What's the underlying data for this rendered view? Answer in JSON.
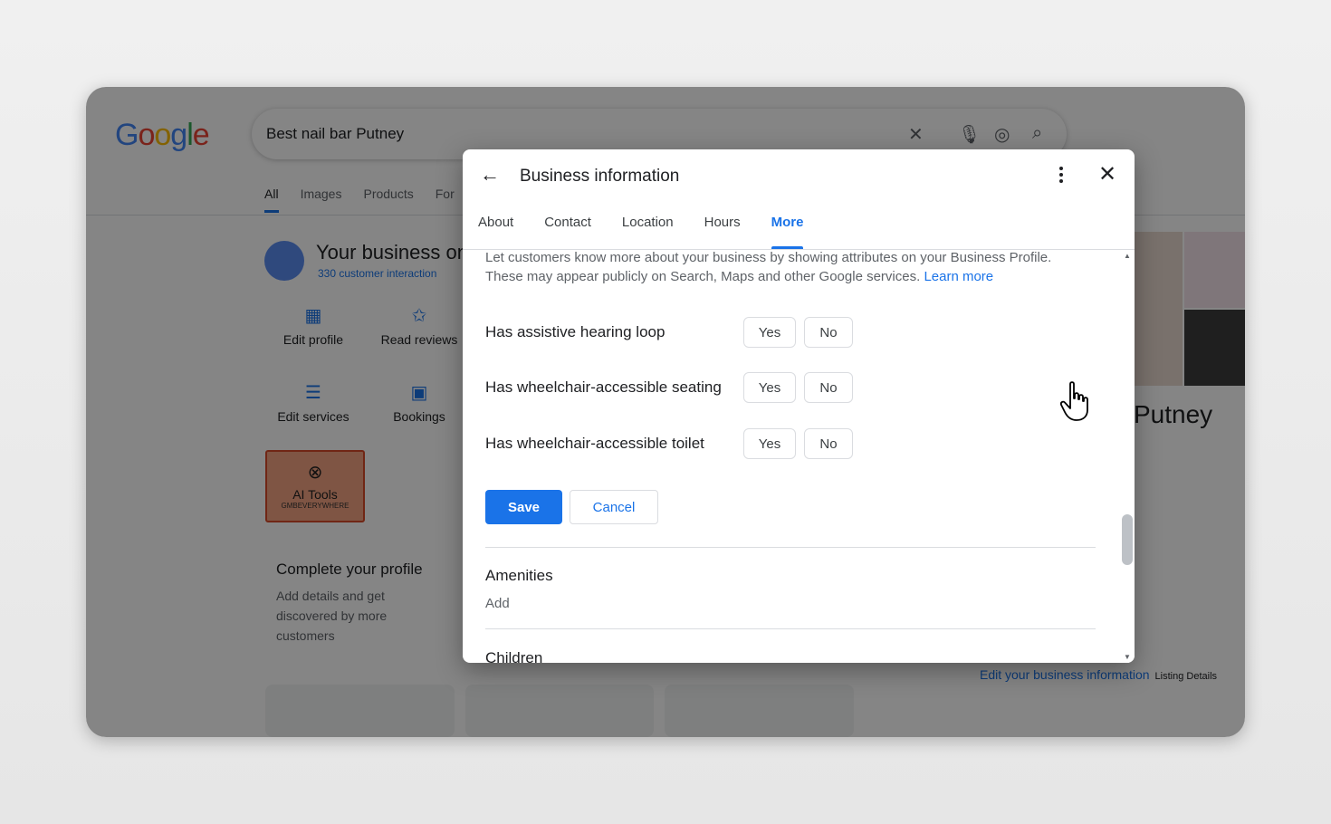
{
  "search": {
    "query": "Best nail bar Putney",
    "tabs": [
      "All",
      "Images",
      "Products",
      "For"
    ]
  },
  "business": {
    "title": "Your business on",
    "interactions": "330 customer interaction",
    "actions": {
      "edit_profile": "Edit profile",
      "read_reviews": "Read reviews",
      "edit_services": "Edit services",
      "bookings": "Bookings"
    },
    "ai_tools": {
      "label": "AI Tools",
      "sub": "GMBEVERYWHERE"
    },
    "complete_card": {
      "title": "Complete your profile",
      "body": "Add details and get discovered by more customers"
    }
  },
  "right_panel": {
    "title": "Putney",
    "edit_link": "Edit your business information",
    "listing_details": "Listing Details"
  },
  "dialog": {
    "title": "Business information",
    "tabs": [
      "About",
      "Contact",
      "Location",
      "Hours",
      "More"
    ],
    "active_tab": "More",
    "intro": "Let customers know more about your business by showing attributes on your Business Profile. These may appear publicly on Search, Maps and other Google services.",
    "learn_more": "Learn more",
    "attributes": [
      {
        "label": "Has assistive hearing loop",
        "yes": "Yes",
        "no": "No"
      },
      {
        "label": "Has wheelchair-accessible seating",
        "yes": "Yes",
        "no": "No"
      },
      {
        "label": "Has wheelchair-accessible toilet",
        "yes": "Yes",
        "no": "No"
      }
    ],
    "save": "Save",
    "cancel": "Cancel",
    "sections": [
      {
        "title": "Amenities",
        "action": "Add"
      },
      {
        "title": "Children",
        "action": ""
      }
    ]
  },
  "colors": {
    "accent": "#1a73e8",
    "overlay": "rgba(0,0,0,0.48)",
    "ai_tools_bg": "#f4a382"
  }
}
